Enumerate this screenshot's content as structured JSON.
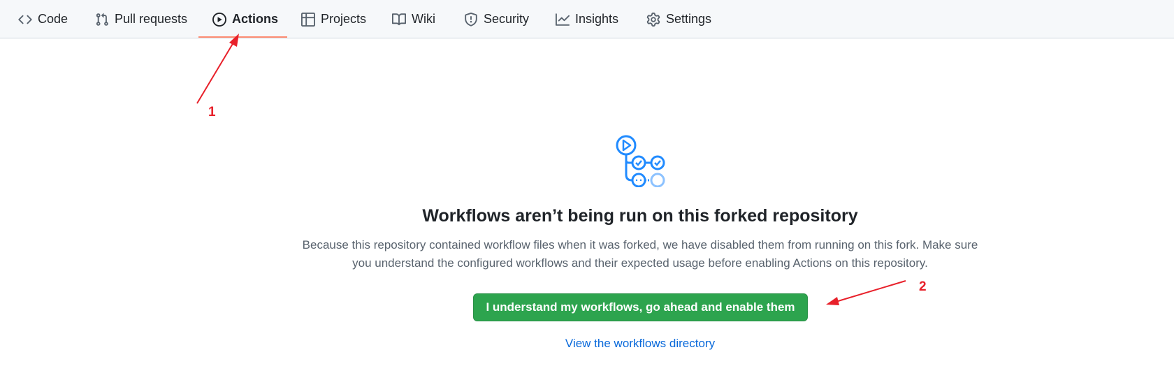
{
  "nav": {
    "tabs": [
      {
        "id": "code",
        "label": "Code",
        "icon": "code-icon"
      },
      {
        "id": "pull-requests",
        "label": "Pull requests",
        "icon": "git-pull-request-icon"
      },
      {
        "id": "actions",
        "label": "Actions",
        "icon": "play-circle-icon",
        "active": true
      },
      {
        "id": "projects",
        "label": "Projects",
        "icon": "table-icon"
      },
      {
        "id": "wiki",
        "label": "Wiki",
        "icon": "book-icon"
      },
      {
        "id": "security",
        "label": "Security",
        "icon": "shield-icon"
      },
      {
        "id": "insights",
        "label": "Insights",
        "icon": "graph-icon"
      },
      {
        "id": "settings",
        "label": "Settings",
        "icon": "gear-icon"
      }
    ]
  },
  "main": {
    "heading": "Workflows aren’t being run on this forked repository",
    "description_line1": "Because this repository contained workflow files when it was forked, we have disabled them from running on this fork. Make sure",
    "description_line2": "you understand the configured workflows and their expected usage before enabling Actions on this repository.",
    "enable_button_label": "I understand my workflows, go ahead and enable them",
    "workflows_link_label": "View the workflows directory"
  },
  "annotations": {
    "marker_1": "1",
    "marker_2": "2"
  },
  "colors": {
    "accent_green": "#2da44e",
    "link_blue": "#0969da",
    "active_tab_underline": "#fd8c73",
    "annotation_red": "#e8202a",
    "graphic_blue": "#218bff"
  }
}
